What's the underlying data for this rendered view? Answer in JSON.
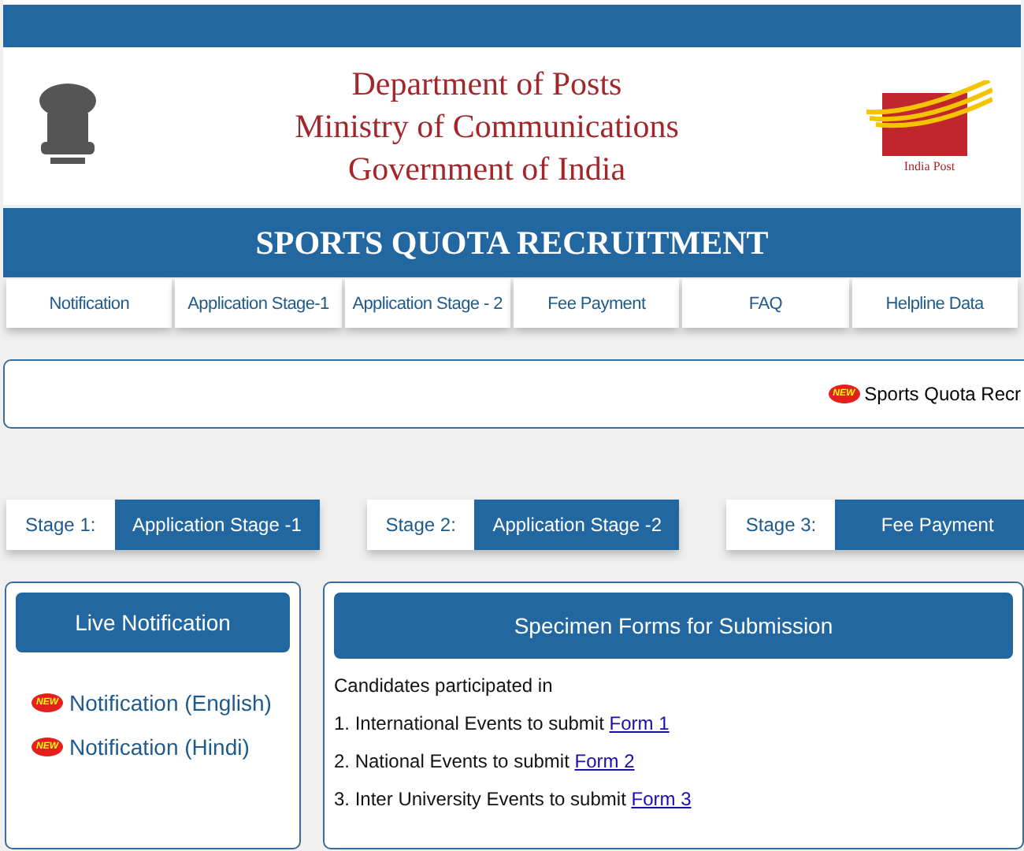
{
  "header": {
    "lines": [
      "Department of Posts",
      "Ministry of Communications",
      "Government of India"
    ],
    "logo_caption": "India Post"
  },
  "banner": {
    "title": "SPORTS QUOTA RECRUITMENT"
  },
  "nav": [
    {
      "label": "Notification"
    },
    {
      "label": "Application Stage-1"
    },
    {
      "label": "Application Stage - 2"
    },
    {
      "label": "Fee Payment"
    },
    {
      "label": "FAQ"
    },
    {
      "label": "Helpline Data"
    }
  ],
  "ticker": {
    "badge": "NEW",
    "text": "Sports Quota Recr"
  },
  "stages": [
    {
      "label": "Stage 1:",
      "button": "Application Stage -1"
    },
    {
      "label": "Stage 2:",
      "button": "Application Stage -2"
    },
    {
      "label": "Stage 3:",
      "button": "Fee Payment"
    }
  ],
  "live": {
    "title": "Live Notification",
    "items": [
      {
        "badge": "NEW",
        "label": "Notification (English)"
      },
      {
        "badge": "NEW",
        "label": "Notification (Hindi)"
      }
    ]
  },
  "forms": {
    "title": "Specimen Forms for Submission",
    "intro": "Candidates participated in",
    "items": [
      {
        "text": "1. International Events to submit",
        "link": "Form 1"
      },
      {
        "text": "2. National Events to submit",
        "link": "Form 2"
      },
      {
        "text": "3. Inter University Events to submit",
        "link": "Form 3"
      }
    ]
  }
}
